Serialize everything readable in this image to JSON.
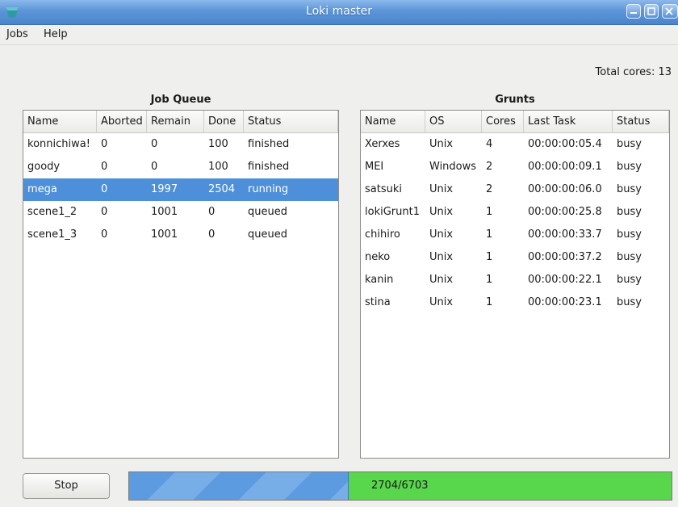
{
  "window": {
    "title": "Loki master"
  },
  "menu": [
    "Jobs",
    "Help"
  ],
  "total_cores_label": "Total cores: 13",
  "job_queue": {
    "title": "Job Queue",
    "columns": [
      "Name",
      "Aborted",
      "Remain",
      "Done",
      "Status"
    ],
    "rows": [
      [
        "konnichiwa!",
        "0",
        "0",
        "100",
        "finished"
      ],
      [
        "goody",
        "0",
        "0",
        "100",
        "finished"
      ],
      [
        "mega",
        "0",
        "1997",
        "2504",
        "running"
      ],
      [
        "scene1_2",
        "0",
        "1001",
        "0",
        "queued"
      ],
      [
        "scene1_3",
        "0",
        "1001",
        "0",
        "queued"
      ]
    ],
    "selected_row": 2
  },
  "grunts": {
    "title": "Grunts",
    "columns": [
      "Name",
      "OS",
      "Cores",
      "Last Task",
      "Status"
    ],
    "rows": [
      [
        "Xerxes",
        "Unix",
        "4",
        "00:00:00:05.4",
        "busy"
      ],
      [
        "MEI",
        "Windows",
        "2",
        "00:00:00:09.1",
        "busy"
      ],
      [
        "satsuki",
        "Unix",
        "2",
        "00:00:00:06.0",
        "busy"
      ],
      [
        "lokiGrunt1",
        "Unix",
        "1",
        "00:00:00:25.8",
        "busy"
      ],
      [
        "chihiro",
        "Unix",
        "1",
        "00:00:00:33.7",
        "busy"
      ],
      [
        "neko",
        "Unix",
        "1",
        "00:00:00:37.2",
        "busy"
      ],
      [
        "kanin",
        "Unix",
        "1",
        "00:00:00:22.1",
        "busy"
      ],
      [
        "stina",
        "Unix",
        "1",
        "00:00:00:23.1",
        "busy"
      ]
    ]
  },
  "stop_label": "Stop",
  "progress": {
    "label": "2704/6703",
    "fraction": 0.404
  },
  "colors": {
    "title_bar": "#5c95d8",
    "selection": "#4d8fd8",
    "progress_done": "#58d64c",
    "progress_fill": "#5d9be0"
  },
  "icons": {
    "app": "loki-app-icon",
    "minimize": "minimize-icon",
    "maximize": "maximize-icon",
    "close": "close-icon"
  }
}
